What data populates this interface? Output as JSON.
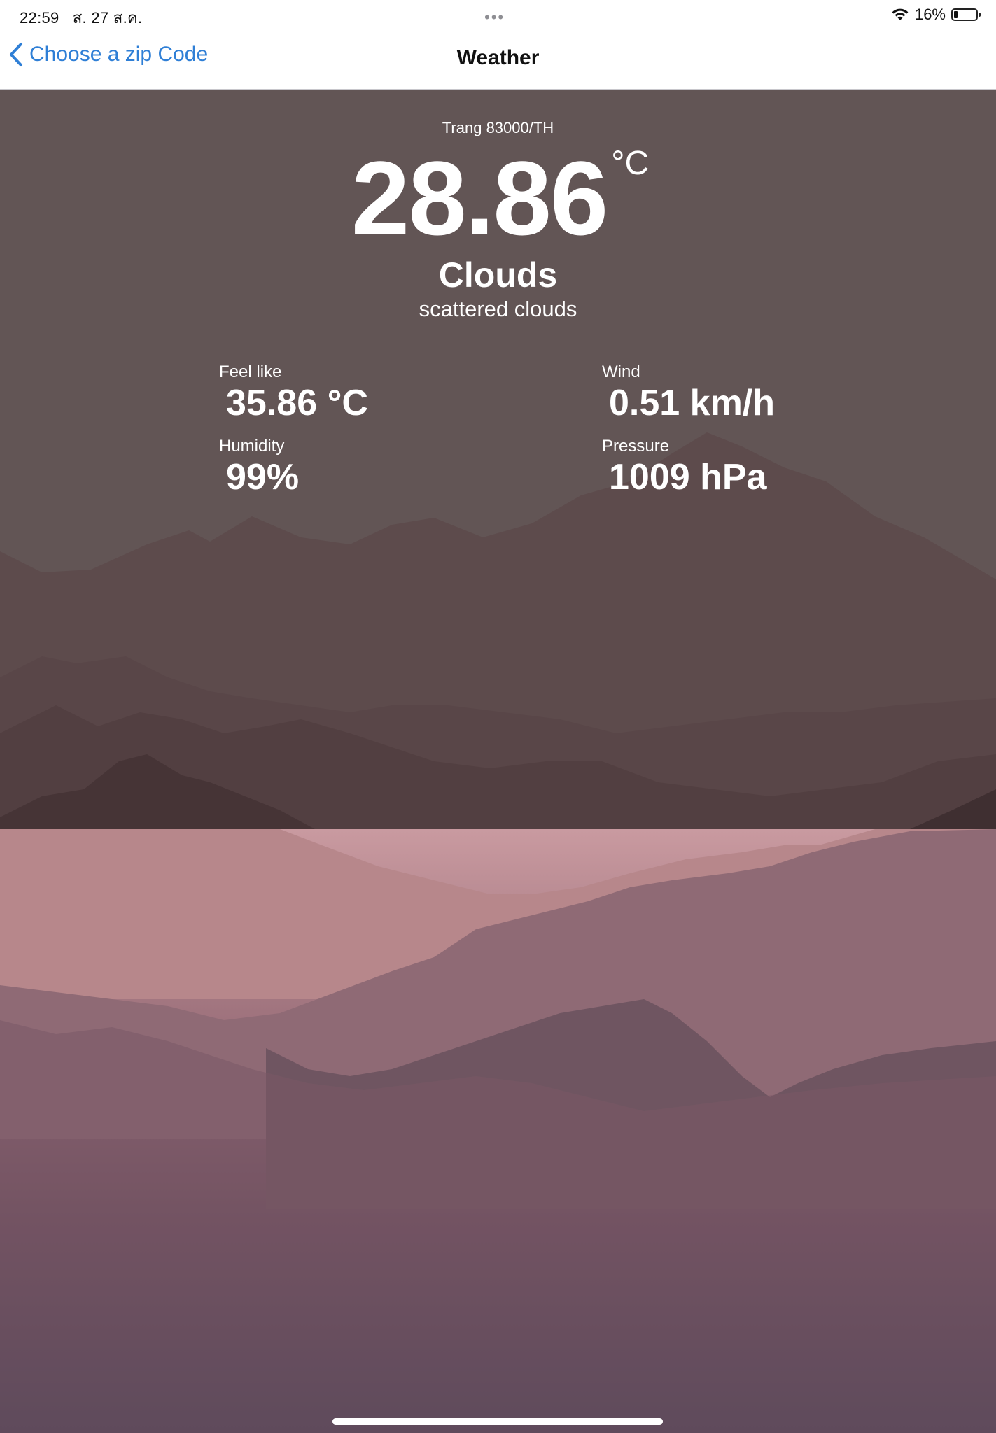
{
  "status_bar": {
    "time": "22:59",
    "date": "ส. 27 ส.ค.",
    "battery_percent": "16%",
    "battery_level": 0.16,
    "multitask_icon": "ellipsis-icon",
    "wifi_icon": "wifi-icon"
  },
  "nav": {
    "back_label": "Choose a zip Code",
    "title": "Weather",
    "accent_color": "#2f7fd6"
  },
  "weather": {
    "location": "Trang 83000/TH",
    "temperature": "28.86",
    "temperature_unit": "°C",
    "condition": "Clouds",
    "description": "scattered clouds",
    "metrics": {
      "feel_like": {
        "label": "Feel like",
        "value": "35.86 °C"
      },
      "wind": {
        "label": "Wind",
        "value": "0.51 km/h"
      },
      "humidity": {
        "label": "Humidity",
        "value": "99%"
      },
      "pressure": {
        "label": "Pressure",
        "value": "1009 hPa"
      }
    }
  }
}
